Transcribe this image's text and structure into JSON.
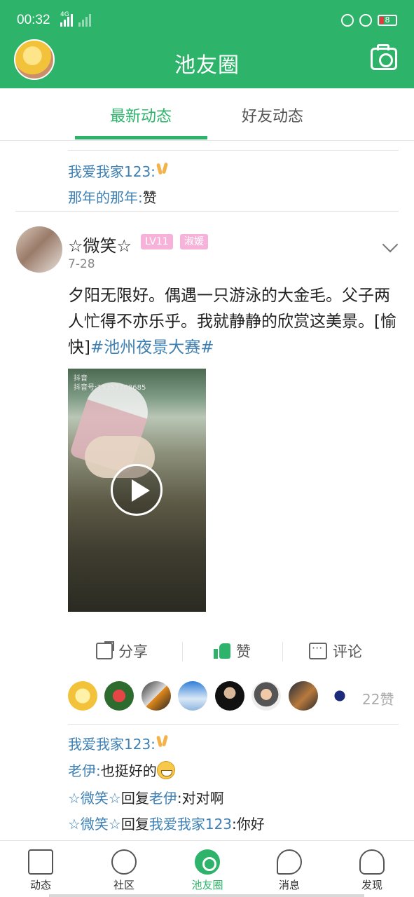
{
  "status_bar": {
    "time": "00:32",
    "network": "4G",
    "battery": "8"
  },
  "header": {
    "title": "池友圈"
  },
  "tabs": [
    {
      "label": "最新动态",
      "active": true
    },
    {
      "label": "好友动态",
      "active": false
    }
  ],
  "prev_comments": [
    {
      "user": "我爱我家123:",
      "text": "",
      "emoji": "victory-hand"
    },
    {
      "user": "那年的那年:",
      "text": "赞"
    }
  ],
  "post": {
    "author": "☆微笑☆",
    "level_badge": "LV11",
    "title_badge": "淑媛",
    "date": "7-28",
    "text": "夕阳无限好。偶遇一只游泳的大金毛。父子两人忙得不亦乐乎。我就静静的欣赏这美景。[愉快]",
    "hashtag": "#池州夜景大赛#",
    "video_watermark_1": "抖音",
    "video_watermark_2": "抖音号:15357768685"
  },
  "actions": {
    "share": "分享",
    "like": "赞",
    "comment": "评论"
  },
  "likes": {
    "count_label": "22赞"
  },
  "comments": [
    {
      "user": "我爱我家123:",
      "emoji": "victory-hand"
    },
    {
      "user": "老伊:",
      "text": "也挺好的",
      "emoji": "grin"
    },
    {
      "user": "☆微笑☆",
      "reply": "回复",
      "target": "老伊",
      "text": ":对对啊"
    },
    {
      "user": "☆微笑☆",
      "reply": "回复",
      "target": "我爱我家123",
      "text": ":你好"
    }
  ],
  "bottom_nav": [
    {
      "label": "动态",
      "icon": "home-icon"
    },
    {
      "label": "社区",
      "icon": "community-icon"
    },
    {
      "label": "池友圈",
      "icon": "pool-circle-icon",
      "active": true
    },
    {
      "label": "消息",
      "icon": "message-icon"
    },
    {
      "label": "发现",
      "icon": "rocket-icon"
    }
  ],
  "colors": {
    "brand": "#2db46a",
    "link": "#3d7fb3",
    "badge": "#f6b2d9"
  }
}
